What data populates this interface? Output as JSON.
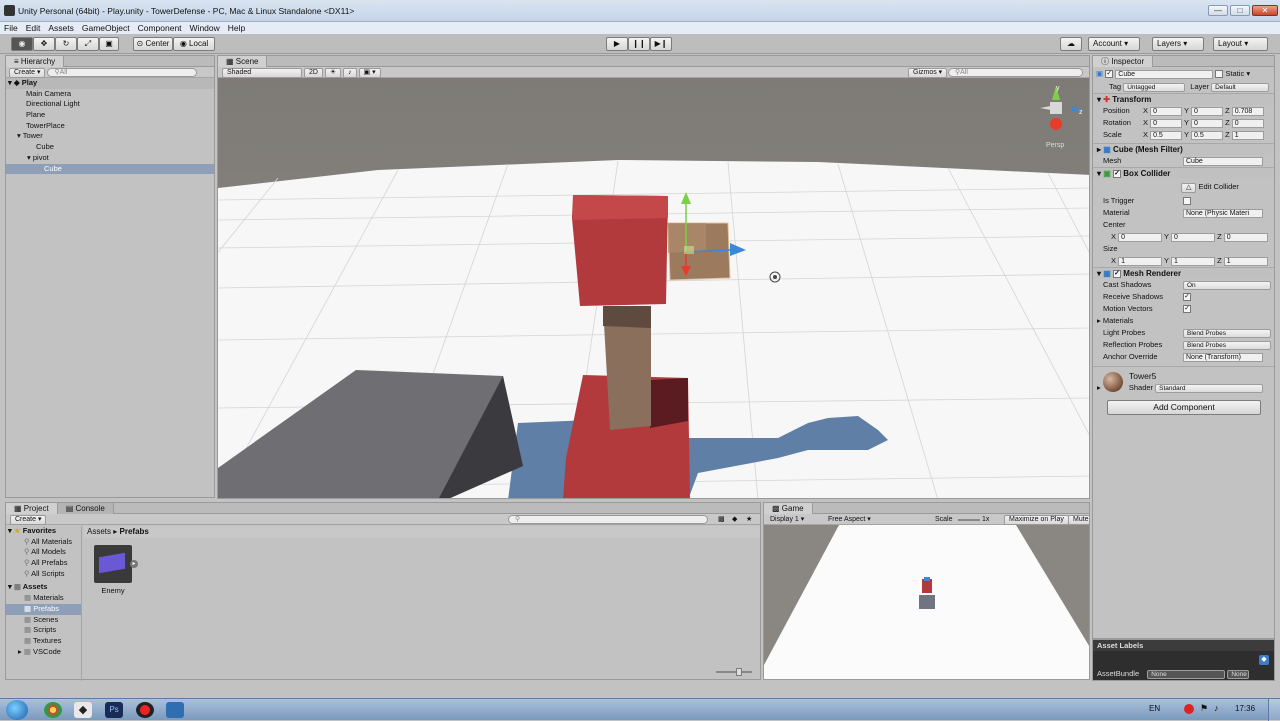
{
  "window": {
    "title": "Unity Personal (64bit) - Play.unity - TowerDefense - PC, Mac & Linux Standalone <DX11>",
    "minimize": "—",
    "maximize": "□",
    "close": "✕"
  },
  "menu": [
    "File",
    "Edit",
    "Assets",
    "GameObject",
    "Component",
    "Window",
    "Help"
  ],
  "toolbar": {
    "pivot_mode": "Center",
    "pivot_space": "Local",
    "account": "Account",
    "layers": "Layers",
    "layout": "Layout"
  },
  "hierarchy": {
    "tab": "Hierarchy",
    "create": "Create",
    "search_placeholder": "All",
    "scene": "Play",
    "items": [
      {
        "label": "Main Camera",
        "depth": 1
      },
      {
        "label": "Directional Light",
        "depth": 1
      },
      {
        "label": "Plane",
        "depth": 1
      },
      {
        "label": "TowerPlace",
        "depth": 1
      },
      {
        "label": "Tower",
        "depth": 1,
        "expanded": true
      },
      {
        "label": "Cube",
        "depth": 2
      },
      {
        "label": "pivot",
        "depth": 2,
        "expanded": true
      },
      {
        "label": "Cube",
        "depth": 3,
        "selected": true
      }
    ]
  },
  "scene": {
    "tab": "Scene",
    "shading": "Shaded",
    "mode2d": "2D",
    "gizmos": "Gizmos",
    "search_placeholder": "All",
    "persp_label": "Persp",
    "axis_y": "y",
    "axis_z": "z"
  },
  "inspector": {
    "tab": "Inspector",
    "object_name": "Cube",
    "static_label": "Static",
    "tag_label": "Tag",
    "tag_value": "Untagged",
    "layer_label": "Layer",
    "layer_value": "Default",
    "transform": {
      "title": "Transform",
      "position": {
        "label": "Position",
        "x": "0",
        "y": "0",
        "z": "0.708"
      },
      "rotation": {
        "label": "Rotation",
        "x": "0",
        "y": "0",
        "z": "0"
      },
      "scale": {
        "label": "Scale",
        "x": "0.5",
        "y": "0.5",
        "z": "1"
      }
    },
    "mesh_filter": {
      "title": "Cube (Mesh Filter)",
      "mesh_label": "Mesh",
      "mesh_value": "Cube"
    },
    "box_collider": {
      "title": "Box Collider",
      "edit_collider": "Edit Collider",
      "is_trigger": "Is Trigger",
      "material_label": "Material",
      "material_value": "None (Physic Materi",
      "center_label": "Center",
      "center": {
        "x": "0",
        "y": "0",
        "z": "0"
      },
      "size_label": "Size",
      "size": {
        "x": "1",
        "y": "1",
        "z": "1"
      }
    },
    "mesh_renderer": {
      "title": "Mesh Renderer",
      "cast_shadows_label": "Cast Shadows",
      "cast_shadows_value": "On",
      "receive_shadows": "Receive Shadows",
      "motion_vectors": "Motion Vectors",
      "materials": "Materials",
      "light_probes_label": "Light Probes",
      "light_probes_value": "Blend Probes",
      "reflection_probes_label": "Reflection Probes",
      "reflection_probes_value": "Blend Probes",
      "anchor_label": "Anchor Override",
      "anchor_value": "None (Transform)"
    },
    "material": {
      "name": "Tower5",
      "shader_label": "Shader",
      "shader_value": "Standard"
    },
    "add_component": "Add Component",
    "asset_labels": "Asset Labels",
    "asset_bundle_label": "AssetBundle",
    "asset_bundle_value": "None",
    "asset_bundle_variant": "None"
  },
  "project": {
    "tab_project": "Project",
    "tab_console": "Console",
    "create": "Create",
    "favorites_title": "Favorites",
    "favorites": [
      "All Materials",
      "All Models",
      "All Prefabs",
      "All Scripts"
    ],
    "assets_title": "Assets",
    "folders": [
      "Materials",
      "Prefabs",
      "Scenes",
      "Scripts",
      "Textures",
      "VSCode"
    ],
    "selected_folder": "Prefabs",
    "breadcrumb_root": "Assets",
    "breadcrumb_sep": "▸",
    "breadcrumb_current": "Prefabs",
    "asset_item": "Enemy"
  },
  "game": {
    "tab": "Game",
    "display": "Display 1",
    "aspect": "Free Aspect",
    "scale_label": "Scale",
    "scale_value": "1x",
    "maximize": "Maximize on Play",
    "mute": "Mute"
  },
  "taskbar": {
    "language": "EN",
    "clock": "17:36"
  },
  "colors": {
    "sky": "#7e7b76",
    "ground": "#f7f7f7",
    "tower_red": "#b23a3c",
    "tower_brown": "#8a6f5d",
    "shadow_blue": "#5f7fa6",
    "block_gray": "#6b6a70"
  }
}
